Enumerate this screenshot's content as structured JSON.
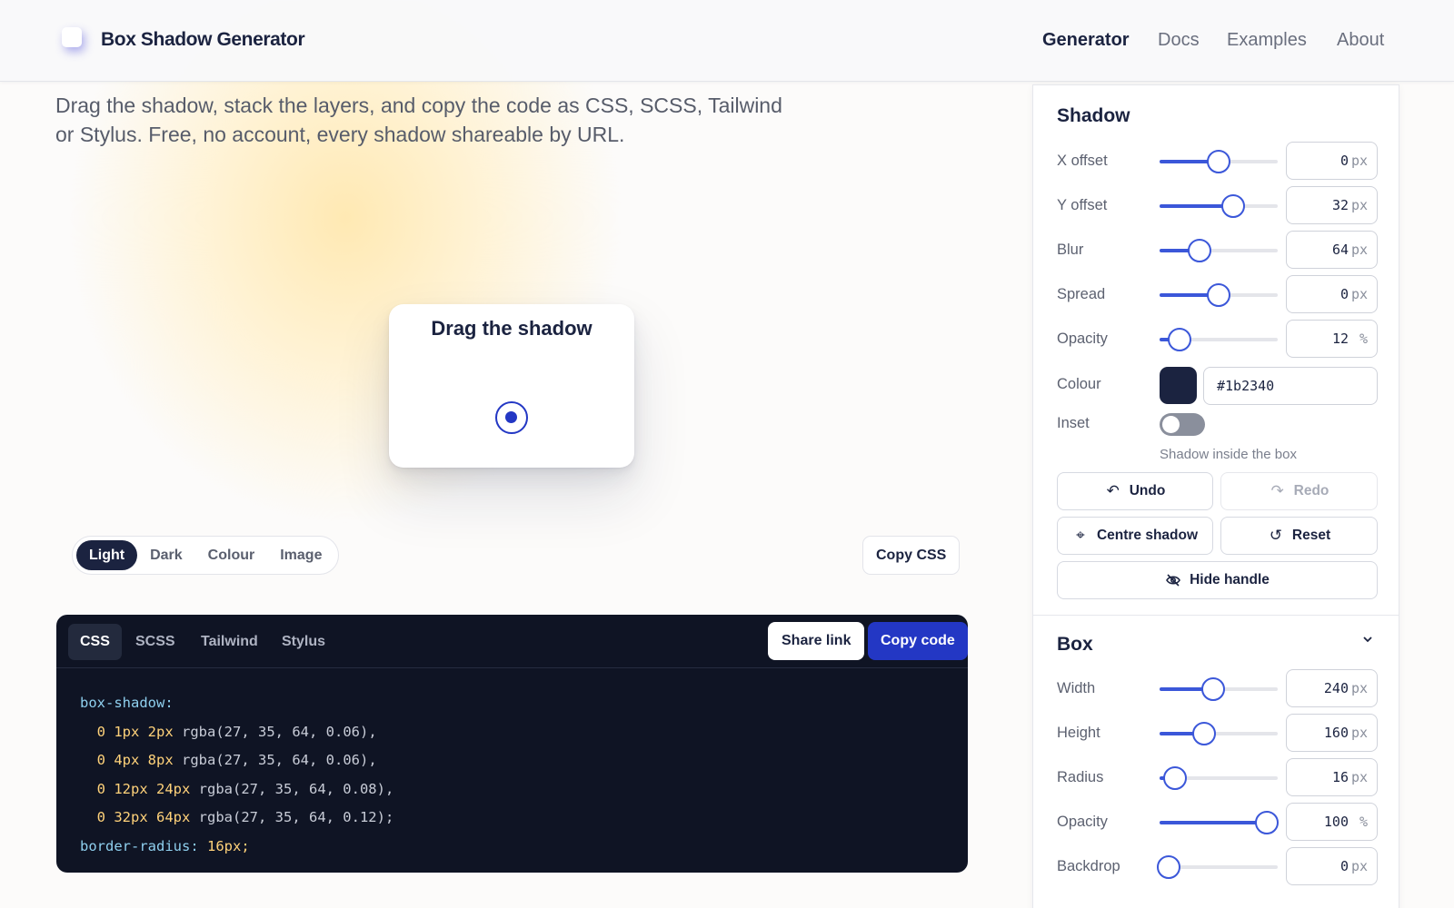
{
  "header": {
    "brand": "Box Shadow Generator",
    "nav": [
      {
        "label": "Generator",
        "active": true
      },
      {
        "label": "Docs"
      },
      {
        "label": "Examples"
      },
      {
        "label": "About"
      }
    ]
  },
  "intro": {
    "line1": "Drag the shadow, stack the layers, and copy the code as CSS, SCSS, Tailwind",
    "line2": "or Stylus. Free, no account, every shadow shareable by URL."
  },
  "preview": {
    "title": "Drag the shadow",
    "background_tabs": [
      "Light",
      "Dark",
      "Colour",
      "Image"
    ],
    "active_background": "Light",
    "copy_css_label": "Copy CSS"
  },
  "code": {
    "tabs": [
      "CSS",
      "SCSS",
      "Tailwind",
      "Stylus"
    ],
    "active_tab": "CSS",
    "share_label": "Share link",
    "copy_label": "Copy code",
    "lines": [
      {
        "prop": "box-shadow:"
      },
      {
        "val": "0 1px 2px",
        "fn": "rgba(27, 35, 64, 0.06),"
      },
      {
        "val": "0 4px 8px",
        "fn": "rgba(27, 35, 64, 0.06),"
      },
      {
        "val": "0 12px 24px",
        "fn": "rgba(27, 35, 64, 0.08),"
      },
      {
        "val": "0 32px 64px",
        "fn": "rgba(27, 35, 64, 0.12);"
      },
      {
        "prop": "border-radius:",
        "val": "16px;"
      }
    ]
  },
  "shadow_panel": {
    "title": "Shadow",
    "rows": [
      {
        "label": "X offset",
        "value": "0",
        "unit": "px",
        "level": 0.5
      },
      {
        "label": "Y offset",
        "value": "32",
        "unit": "px",
        "level": 0.62
      },
      {
        "label": "Blur",
        "value": "64",
        "unit": "px",
        "level": 0.34
      },
      {
        "label": "Spread",
        "value": "0",
        "unit": "px",
        "level": 0.5
      },
      {
        "label": "Opacity",
        "value": "12",
        "unit": "%",
        "level": 0.17
      }
    ],
    "colour_label": "Colour",
    "colour_value": "#1b2340",
    "inset_label": "Inset",
    "inset_on": false,
    "inset_helper": "Shadow inside the box",
    "undo_label": "Undo",
    "redo_label": "Redo",
    "centre_label": "Centre shadow",
    "reset_label": "Reset",
    "hide_handle_label": "Hide handle"
  },
  "box_panel": {
    "title": "Box",
    "rows": [
      {
        "label": "Width",
        "value": "240",
        "unit": "px",
        "level": 0.45
      },
      {
        "label": "Height",
        "value": "160",
        "unit": "px",
        "level": 0.38
      },
      {
        "label": "Radius",
        "value": "16",
        "unit": "px",
        "level": 0.13
      },
      {
        "label": "Opacity",
        "value": "100",
        "unit": "%",
        "level": 0.91
      },
      {
        "label": "Backdrop",
        "value": "0",
        "unit": "px",
        "level": 0.08
      }
    ]
  },
  "colors": {
    "accent": "#2337c4",
    "slider": "#3b57d9",
    "ink": "#1b2340",
    "code_bg": "#0f1424"
  }
}
